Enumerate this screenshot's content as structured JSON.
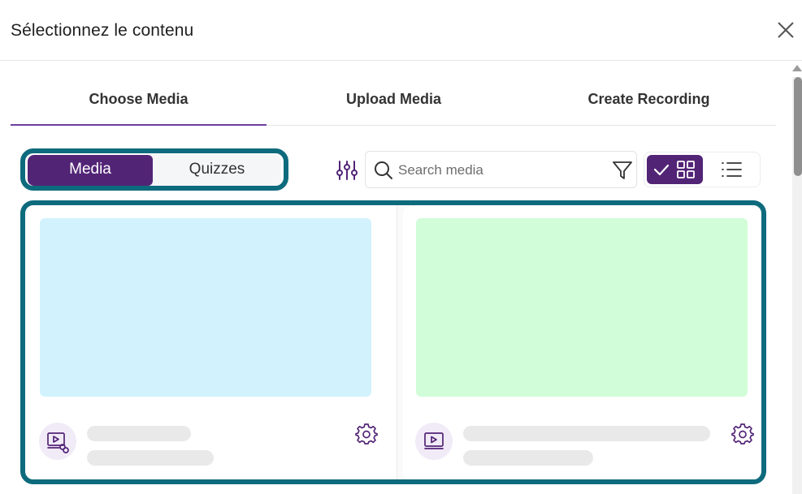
{
  "dialog": {
    "title": "Sélectionnez le contenu",
    "close_icon": "close-icon"
  },
  "tabs": [
    {
      "label": "Choose Media",
      "active": true
    },
    {
      "label": "Upload Media",
      "active": false
    },
    {
      "label": "Create Recording",
      "active": false
    }
  ],
  "toggle": {
    "options": [
      "Media",
      "Quizzes"
    ],
    "selected": "Media"
  },
  "search": {
    "placeholder": "Search media",
    "value": ""
  },
  "toolbar": {
    "filter_icon": "sliders-icon",
    "funnel_icon": "funnel-icon",
    "view_mode": "grid"
  },
  "colors": {
    "accent": "#522476",
    "highlight_border": "#0e6b7d",
    "card_1_thumbnail": "#d2f2fe",
    "card_2_thumbnail": "#d1fdd8",
    "icon_bg": "#f1ebf8"
  },
  "cards": [
    {
      "thumbnail_color": "#d2f2fe",
      "type_icon": "video-link-icon",
      "settings_icon": "gear-icon"
    },
    {
      "thumbnail_color": "#d1fdd8",
      "type_icon": "video-icon",
      "settings_icon": "gear-icon"
    }
  ]
}
